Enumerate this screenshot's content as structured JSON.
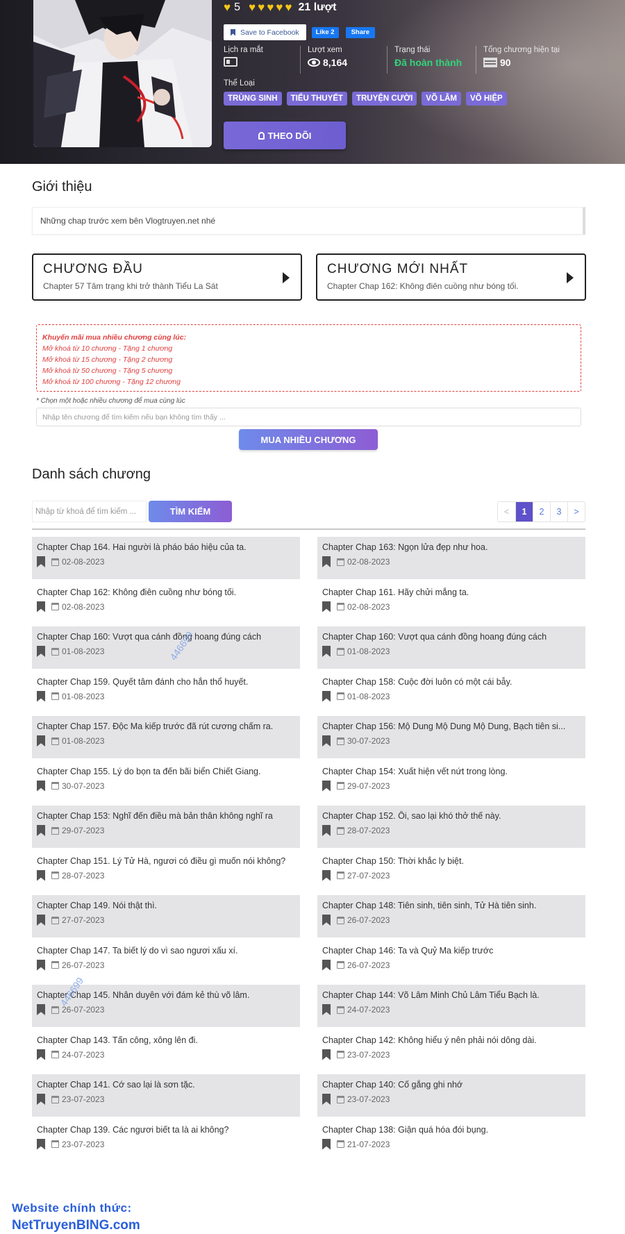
{
  "manga": {
    "rating_value": "5",
    "votes": "21 lượt",
    "social": {
      "save_fb": "Save to Facebook",
      "like": "Like 2",
      "share": "Share"
    },
    "stats": [
      {
        "label": "Lịch ra mắt",
        "value": ""
      },
      {
        "label": "Lượt xem",
        "value": "8,164"
      },
      {
        "label": "Trạng thái",
        "value": "Đã hoàn thành"
      },
      {
        "label": "Tổng chương hiện tại",
        "value": "90"
      }
    ],
    "genre_label": "Thể Loại",
    "genres": [
      "Trùng Sinh",
      "Tiểu Thuyết",
      "Truyện Cười",
      "Võ Lâm",
      "Võ Hiệp"
    ],
    "follow": "THEO DÕI"
  },
  "intro": {
    "title": "Giới thiệu",
    "text": "Những chap trước xem bên Vlogtruyen.net nhé"
  },
  "first_chapter": {
    "title": "CHƯƠNG ĐẦU",
    "sub": "Chapter 57 Tâm trạng khi trở thành Tiểu La Sát"
  },
  "latest_chapter": {
    "title": "CHƯƠNG MỚI NHẤT",
    "sub": "Chapter Chap 162: Không điên cuồng như bóng tối."
  },
  "promo": {
    "heading": "Khuyến mãi mua nhiều chương cùng lúc:",
    "lines": [
      "Mở khoá từ 10 chương - Tặng 1 chương",
      "Mở khoá từ 15 chương - Tặng 2 chương",
      "Mở khoá từ 50 chương - Tặng 5 chương",
      "Mở khoá từ 100 chương - Tặng 12 chương"
    ],
    "choose_hint": "* Chọn một hoặc nhiều chương để mua cùng lúc",
    "input_placeholder": "Nhập tên chương để tìm kiếm nếu bạn không tìm thấy ...",
    "buy_button": "MUA NHIỀU CHƯƠNG"
  },
  "chapter_list": {
    "title": "Danh sách chương",
    "search_placeholder": "Nhập từ khoá để tìm kiếm ...",
    "search_button": "TÌM KIẾM",
    "pager": [
      "<",
      "1",
      "2",
      "3",
      ">"
    ],
    "rows": [
      [
        {
          "name": "Chapter Chap 164. Hai người là pháo báo hiệu của ta.",
          "date": "02-08-2023"
        },
        {
          "name": "Chapter Chap 163: Ngọn lửa đẹp như hoa.",
          "date": "02-08-2023"
        }
      ],
      [
        {
          "name": "Chapter Chap 162: Không điên cuồng như bóng tối.",
          "date": "02-08-2023"
        },
        {
          "name": "Chapter Chap 161. Hãy chửi mắng ta.",
          "date": "02-08-2023"
        }
      ],
      [
        {
          "name": "Chapter Chap 160: Vượt qua cánh đồng hoang đúng cách",
          "date": "01-08-2023"
        },
        {
          "name": "Chapter Chap 160: Vượt qua cánh đồng hoang đúng cách",
          "date": "01-08-2023"
        }
      ],
      [
        {
          "name": "Chapter Chap 159. Quyết tâm đánh cho hắn thổ huyết.",
          "date": "01-08-2023"
        },
        {
          "name": "Chapter Chap 158: Cuộc đời luôn có một cái bẫy.",
          "date": "01-08-2023"
        }
      ],
      [
        {
          "name": "Chapter Chap 157. Độc Ma kiếp trước đã rút cương chấm ra.",
          "date": "01-08-2023"
        },
        {
          "name": "Chapter Chap 156: Mộ Dung Mộ Dung Mộ Dung, Bạch tiên si...",
          "date": "30-07-2023"
        }
      ],
      [
        {
          "name": "Chapter Chap 155. Lý do bọn ta đến bãi biển Chiết Giang.",
          "date": "30-07-2023"
        },
        {
          "name": "Chapter Chap 154: Xuất hiện vết nứt trong lòng.",
          "date": "29-07-2023"
        }
      ],
      [
        {
          "name": "Chapter Chap 153: Nghĩ đến điều mà bản thân không nghĩ ra",
          "date": "29-07-2023"
        },
        {
          "name": "Chapter Chap 152. Ôi, sao lại khó thở thế này.",
          "date": "28-07-2023"
        }
      ],
      [
        {
          "name": "Chapter Chap 151. Lý Tử Hà, ngươi có điều gì muốn nói không?",
          "date": "28-07-2023"
        },
        {
          "name": "Chapter Chap 150: Thời khắc ly biệt.",
          "date": "27-07-2023"
        }
      ],
      [
        {
          "name": "Chapter Chap 149. Nói thật thì.",
          "date": "27-07-2023"
        },
        {
          "name": "Chapter Chap 148: Tiên sinh, tiên sinh, Tử Hà tiên sinh.",
          "date": "26-07-2023"
        }
      ],
      [
        {
          "name": "Chapter Chap 147. Ta biết lý do vì sao ngươi xấu xí.",
          "date": "26-07-2023"
        },
        {
          "name": "Chapter Chap 146: Ta và Quỷ Ma kiếp trước",
          "date": "26-07-2023"
        }
      ],
      [
        {
          "name": "Chapter Chap 145. Nhân duyên với đám kẻ thù võ lâm.",
          "date": "26-07-2023"
        },
        {
          "name": "Chapter Chap 144: Võ Lâm Minh Chủ Lâm Tiểu Bạch là.",
          "date": "24-07-2023"
        }
      ],
      [
        {
          "name": "Chapter Chap 143. Tấn công, xông lên đi.",
          "date": "24-07-2023"
        },
        {
          "name": "Chapter Chap 142: Không hiểu ý nên phải nói dông dài.",
          "date": "23-07-2023"
        }
      ],
      [
        {
          "name": "Chapter Chap 141. Cớ sao lại là sơn tặc.",
          "date": "23-07-2023"
        },
        {
          "name": "Chapter Chap 140: Cố gắng ghi nhớ",
          "date": "23-07-2023"
        }
      ],
      [
        {
          "name": "Chapter Chap 139. Các ngươi biết ta là ai không?",
          "date": "23-07-2023"
        },
        {
          "name": "Chapter Chap 138: Giận quá hóa đói bụng.",
          "date": "21-07-2023"
        }
      ]
    ]
  },
  "watermark": "446699",
  "footer": {
    "label": "Website chính thức:",
    "url": "NetTruyenBING.com"
  },
  "colors": {
    "accent": "#6d5ecf",
    "genre_bg": "#7a6bd6",
    "status_green": "#33d27a",
    "footer_blue": "#2a5fd9",
    "promo_red": "#e04040"
  }
}
